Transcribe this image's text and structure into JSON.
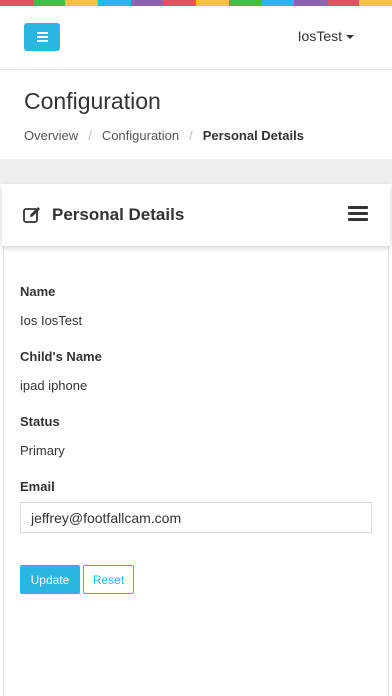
{
  "rainbow_colors": [
    "#e4505f",
    "#4db848",
    "#f7c23b",
    "#29b6e0",
    "#8b62ad",
    "#e4505f",
    "#f7c23b",
    "#4db848",
    "#29b6e0",
    "#8b62ad",
    "#e4505f",
    "#f7c23b"
  ],
  "header": {
    "menu_icon": "hamburger-icon",
    "user_name": "IosTest",
    "accent": "#29b6e0"
  },
  "page": {
    "title": "Configuration",
    "breadcrumb": [
      "Overview",
      "Configuration",
      "Personal Details"
    ],
    "separator": "/"
  },
  "panel": {
    "title": "Personal Details",
    "icon": "edit-icon",
    "menu_icon": "hamburger-icon"
  },
  "fields": {
    "name_label": "Name",
    "name_value": "Ios IosTest",
    "child_label": "Child's Name",
    "child_value": "ipad iphone",
    "status_label": "Status",
    "status_value": "Primary",
    "email_label": "Email",
    "email_value": "jeffrey@footfallcam.com"
  },
  "buttons": {
    "update": "Update",
    "reset": "Reset"
  }
}
